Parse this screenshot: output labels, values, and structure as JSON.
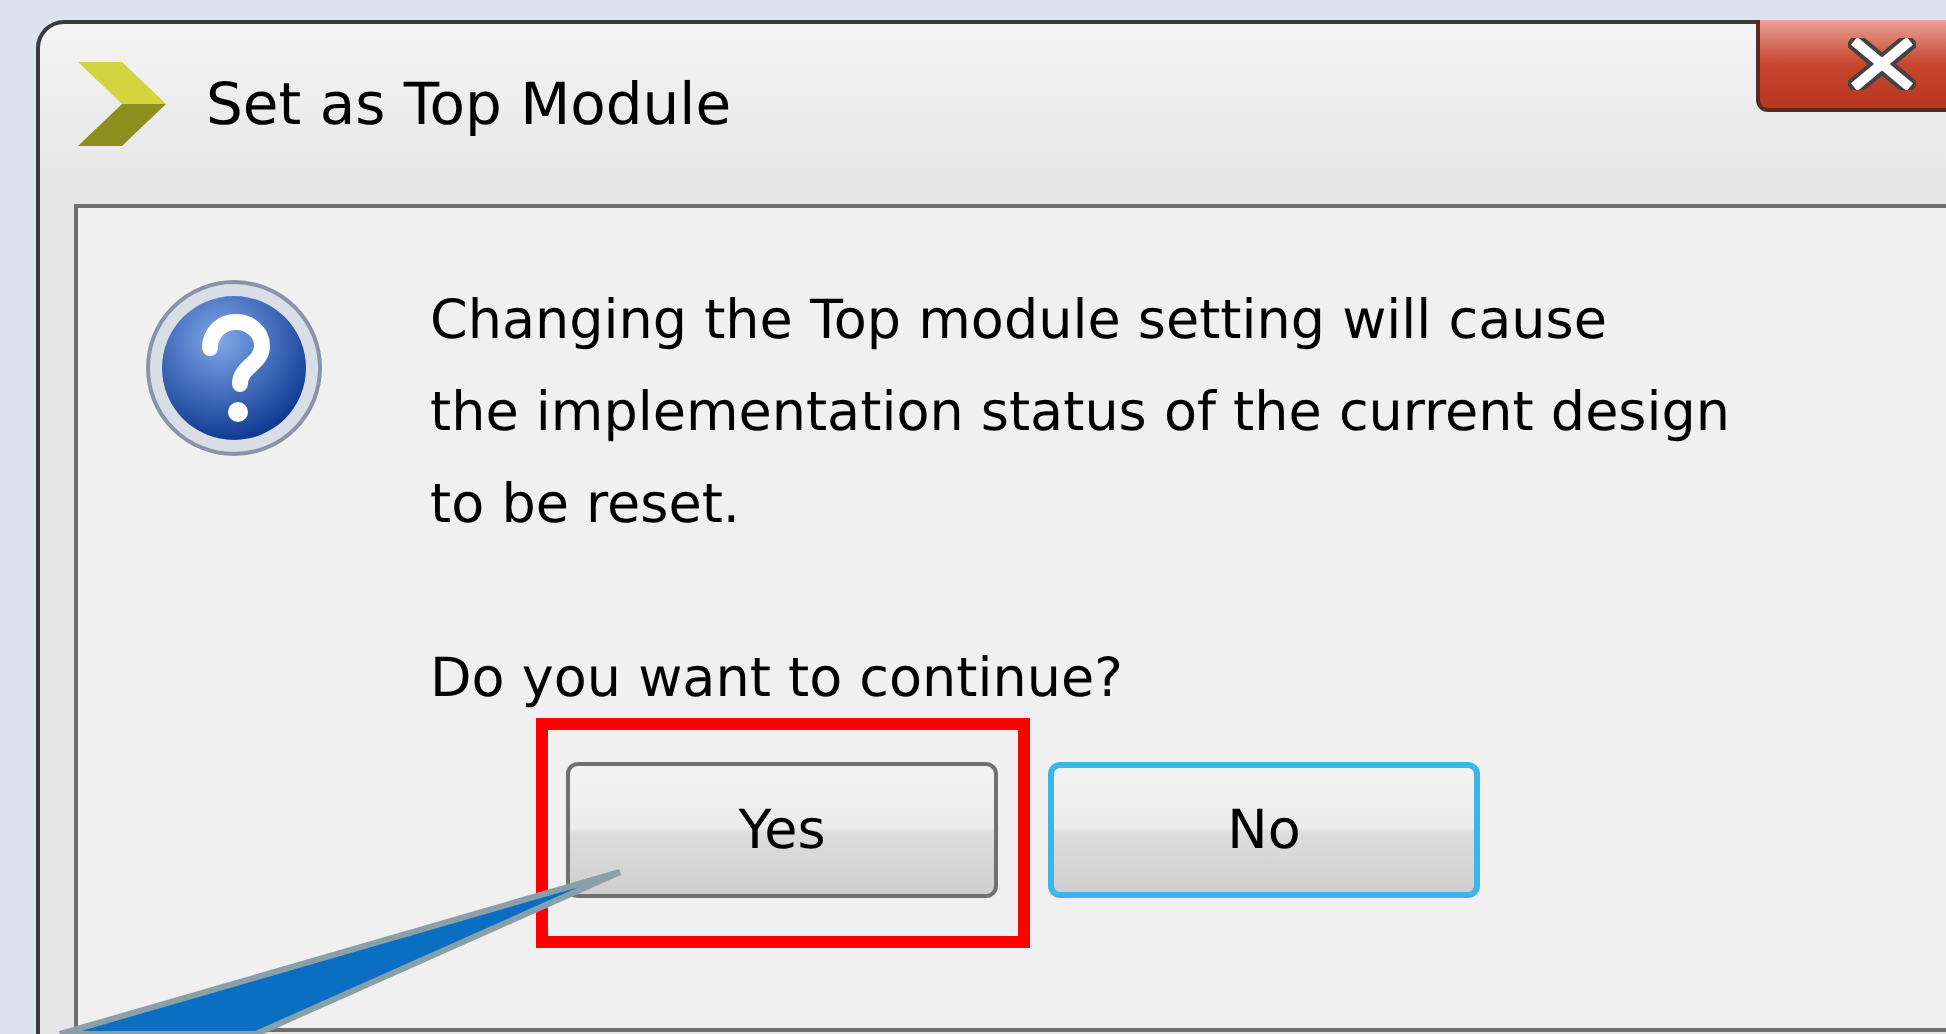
{
  "window": {
    "title": "Set as Top Module"
  },
  "message": "Changing the Top module setting will cause\nthe implementation status of the current design\nto be reset.",
  "question": "Do you want to continue?",
  "buttons": [
    {
      "label": "Yes",
      "focused": false,
      "highlighted": true
    },
    {
      "label": "No",
      "focused": true,
      "highlighted": false
    }
  ]
}
